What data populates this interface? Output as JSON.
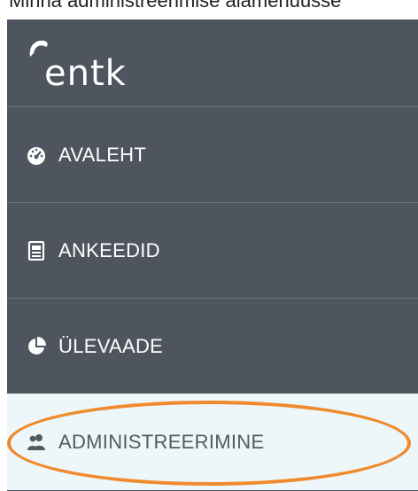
{
  "caption": "Minna administreerimise alamenüüsse",
  "logo": {
    "text": "entk"
  },
  "sidebar": {
    "items": [
      {
        "label": "AVALEHT",
        "icon": "dashboard-icon"
      },
      {
        "label": "ANKEEDID",
        "icon": "forms-icon"
      },
      {
        "label": "ÜLEVAADE",
        "icon": "pie-chart-icon"
      },
      {
        "label": "ADMINISTREERIMINE",
        "icon": "users-icon",
        "active": true
      }
    ]
  },
  "colors": {
    "sidebar_bg": "#4f555e",
    "active_bg": "#edf7f9",
    "highlight": "#f08a2e"
  }
}
